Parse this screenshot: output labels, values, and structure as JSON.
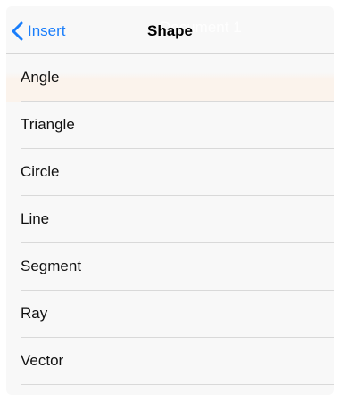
{
  "background_title": "Document 1",
  "header": {
    "back_label": "Insert",
    "title": "Shape"
  },
  "shapes": [
    {
      "label": "Angle"
    },
    {
      "label": "Triangle"
    },
    {
      "label": "Circle"
    },
    {
      "label": "Line"
    },
    {
      "label": "Segment"
    },
    {
      "label": "Ray"
    },
    {
      "label": "Vector"
    }
  ],
  "colors": {
    "accent": "#1a7efb",
    "panel_background": "#f8f8f8",
    "separator": "#d9d9d9"
  },
  "icons": {
    "back": "chevron-left-icon"
  }
}
